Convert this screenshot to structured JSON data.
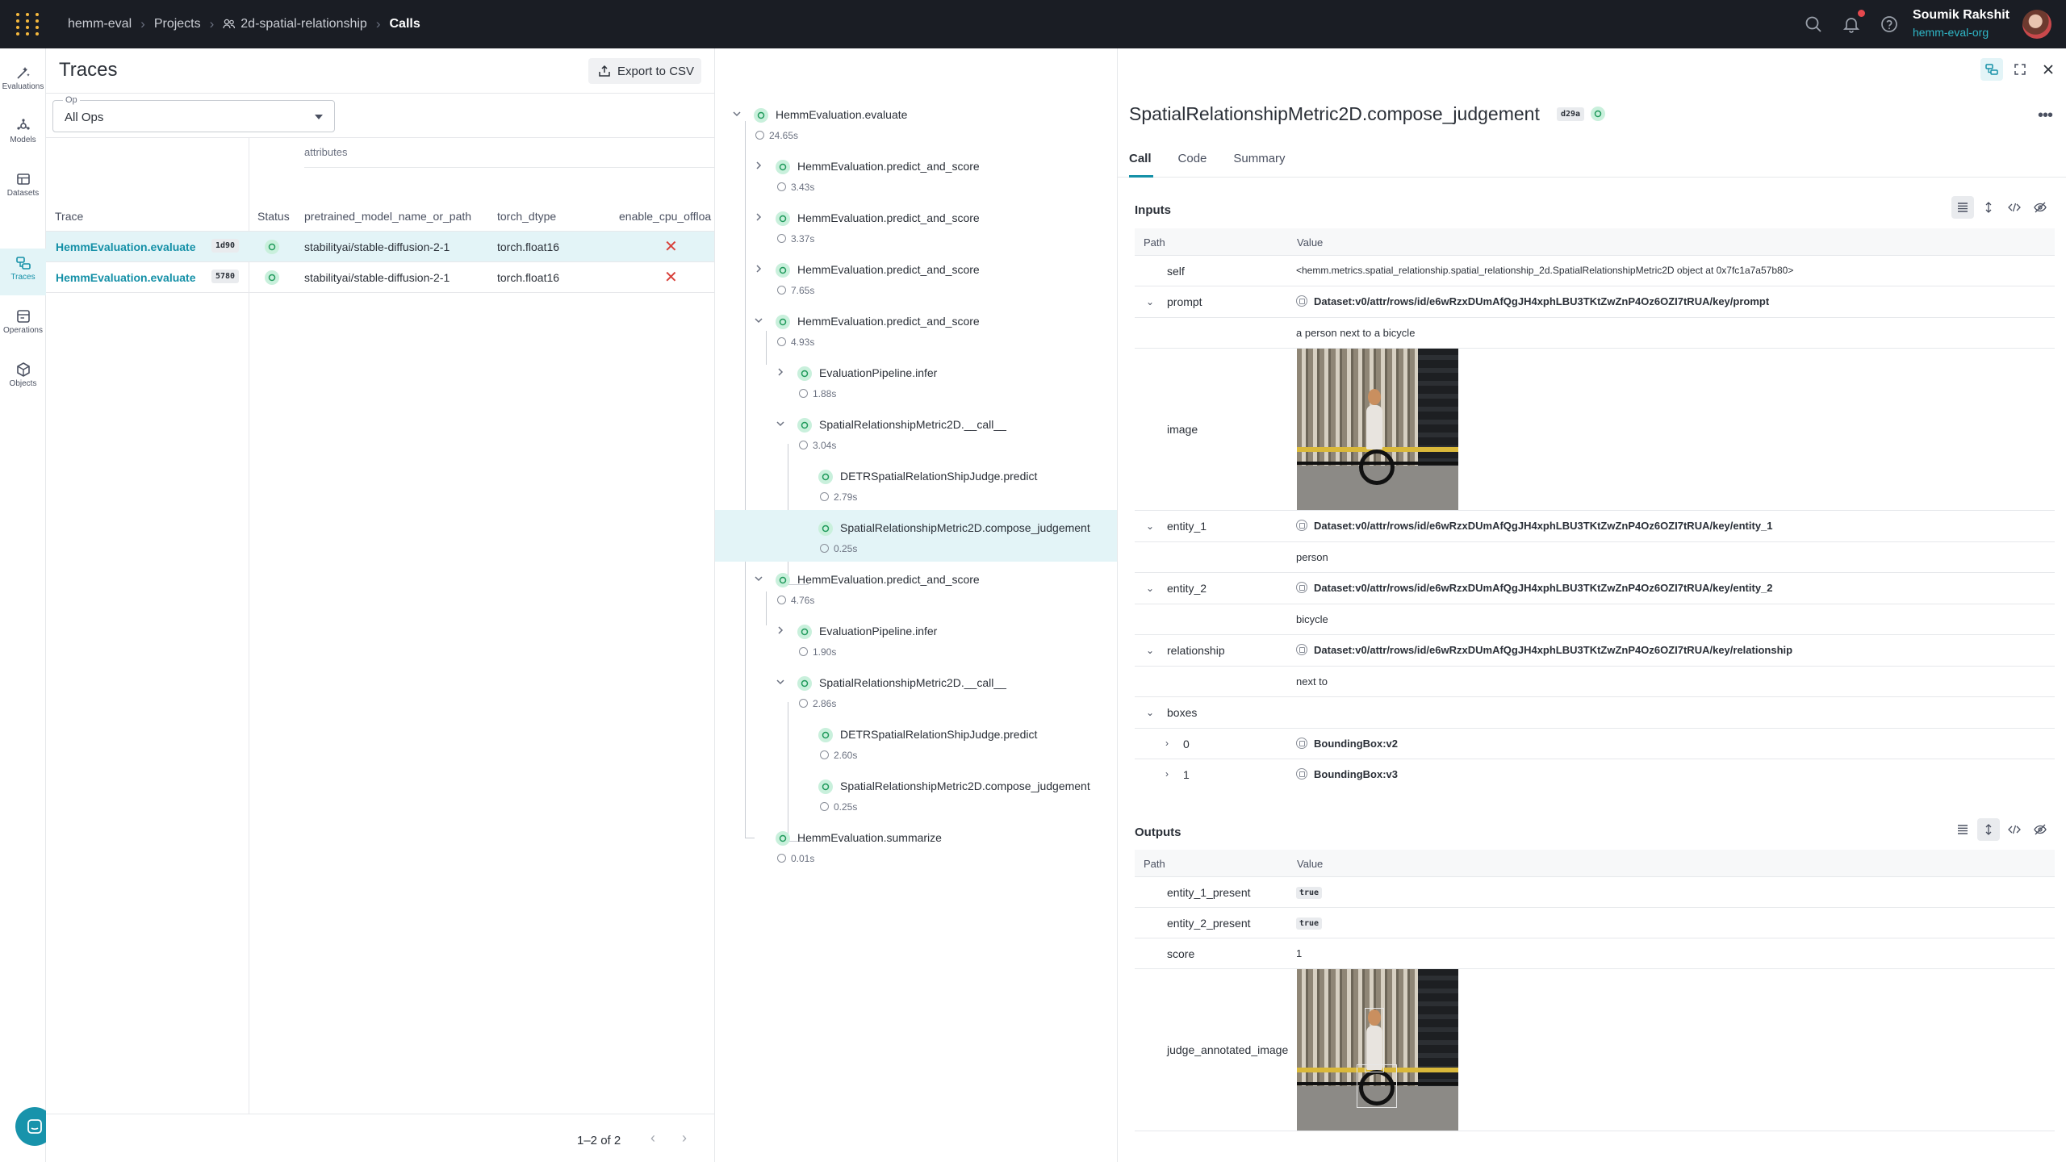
{
  "topbar": {
    "breadcrumbs": [
      "hemm-eval",
      "Projects",
      "2d-spatial-relationship",
      "Calls"
    ],
    "user_name": "Soumik Rakshit",
    "user_org": "hemm-eval-org"
  },
  "leftnav": {
    "items": [
      {
        "label": "Evaluations",
        "icon": "evaluations-icon"
      },
      {
        "label": "Models",
        "icon": "models-icon"
      },
      {
        "label": "Datasets",
        "icon": "datasets-icon"
      },
      {
        "label": "Traces",
        "icon": "traces-icon",
        "active": true
      },
      {
        "label": "Operations",
        "icon": "operations-icon"
      },
      {
        "label": "Objects",
        "icon": "objects-icon"
      }
    ]
  },
  "traces": {
    "title": "Traces",
    "export_label": "Export to CSV",
    "op_label": "Op",
    "op_value": "All Ops",
    "group_header": "attributes",
    "columns": [
      "Trace",
      "Status",
      "pretrained_model_name_or_path",
      "torch_dtype",
      "enable_cpu_offloa"
    ],
    "rows": [
      {
        "trace": "HemmEvaluation.evaluate",
        "id": "1d90",
        "status": "success",
        "model": "stabilityai/stable-diffusion-2-1",
        "dtype": "torch.float16",
        "offload": "false"
      },
      {
        "trace": "HemmEvaluation.evaluate",
        "id": "5780",
        "status": "success",
        "model": "stabilityai/stable-diffusion-2-1",
        "dtype": "torch.float16",
        "offload": "false"
      }
    ],
    "pagination": "1–2 of 2"
  },
  "tree": {
    "nodes": [
      {
        "name": "HemmEvaluation.evaluate",
        "duration": "24.65s"
      },
      {
        "name": "HemmEvaluation.predict_and_score",
        "duration": "3.43s"
      },
      {
        "name": "HemmEvaluation.predict_and_score",
        "duration": "3.37s"
      },
      {
        "name": "HemmEvaluation.predict_and_score",
        "duration": "7.65s"
      },
      {
        "name": "HemmEvaluation.predict_and_score",
        "duration": "4.93s"
      },
      {
        "name": "EvaluationPipeline.infer",
        "duration": "1.88s"
      },
      {
        "name": "SpatialRelationshipMetric2D.__call__",
        "duration": "3.04s"
      },
      {
        "name": "DETRSpatialRelationShipJudge.predict",
        "duration": "2.79s"
      },
      {
        "name": "SpatialRelationshipMetric2D.compose_judgement",
        "duration": "0.25s"
      },
      {
        "name": "HemmEvaluation.predict_and_score",
        "duration": "4.76s"
      },
      {
        "name": "EvaluationPipeline.infer",
        "duration": "1.90s"
      },
      {
        "name": "SpatialRelationshipMetric2D.__call__",
        "duration": "2.86s"
      },
      {
        "name": "DETRSpatialRelationShipJudge.predict",
        "duration": "2.60s"
      },
      {
        "name": "SpatialRelationshipMetric2D.compose_judgement",
        "duration": "0.25s"
      },
      {
        "name": "HemmEvaluation.summarize",
        "duration": "0.01s"
      }
    ]
  },
  "detail": {
    "title": "SpatialRelationshipMetric2D.compose_judgement",
    "badge": "d29a",
    "tabs": [
      "Call",
      "Code",
      "Summary"
    ],
    "inputs_label": "Inputs",
    "outputs_label": "Outputs",
    "path_header": "Path",
    "value_header": "Value",
    "inputs": {
      "self_key": "self",
      "self_val": "<hemm.metrics.spatial_relationship.spatial_relationship_2d.SpatialRelationshipMetric2D object at 0x7fc1a7a57b80>",
      "prompt_key": "prompt",
      "prompt_ref": "Dataset:v0/attr/rows/id/e6wRzxDUmAfQgJH4xphLBU3TKtZwZnP4Oz6OZI7tRUA/key/prompt",
      "prompt_val": "a person next to a bicycle",
      "image_key": "image",
      "entity1_key": "entity_1",
      "entity1_ref": "Dataset:v0/attr/rows/id/e6wRzxDUmAfQgJH4xphLBU3TKtZwZnP4Oz6OZI7tRUA/key/entity_1",
      "entity1_val": "person",
      "entity2_key": "entity_2",
      "entity2_ref": "Dataset:v0/attr/rows/id/e6wRzxDUmAfQgJH4xphLBU3TKtZwZnP4Oz6OZI7tRUA/key/entity_2",
      "entity2_val": "bicycle",
      "rel_key": "relationship",
      "rel_ref": "Dataset:v0/attr/rows/id/e6wRzxDUmAfQgJH4xphLBU3TKtZwZnP4Oz6OZI7tRUA/key/relationship",
      "rel_val": "next to",
      "boxes_key": "boxes",
      "box0_key": "0",
      "box0_val": "BoundingBox:v2",
      "box1_key": "1",
      "box1_val": "BoundingBox:v3"
    },
    "outputs": {
      "e1_key": "entity_1_present",
      "e1_val": "true",
      "e2_key": "entity_2_present",
      "e2_val": "true",
      "score_key": "score",
      "score_val": "1",
      "img_key": "judge_annotated_image"
    }
  }
}
